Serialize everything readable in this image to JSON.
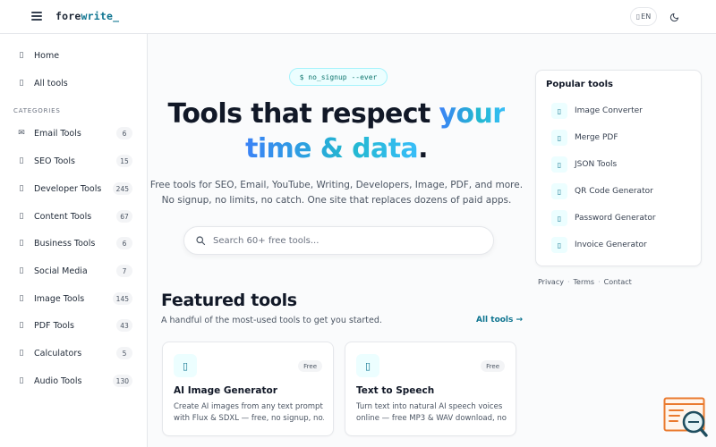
{
  "header": {
    "logo_part1": "fore",
    "logo_part2": "write",
    "logo_cursor": "_",
    "lang_label": "EN"
  },
  "sidebar": {
    "top_items": [
      {
        "label": "Home",
        "icon": "home-icon"
      },
      {
        "label": "All tools",
        "icon": "grid-icon"
      }
    ],
    "category_heading": "CATEGORIES",
    "categories": [
      {
        "label": "Email Tools",
        "count": "6",
        "icon": "mail-icon"
      },
      {
        "label": "SEO Tools",
        "count": "15",
        "icon": "seo-icon"
      },
      {
        "label": "Developer Tools",
        "count": "245",
        "icon": "code-icon"
      },
      {
        "label": "Content Tools",
        "count": "67",
        "icon": "content-icon"
      },
      {
        "label": "Business Tools",
        "count": "6",
        "icon": "briefcase-icon"
      },
      {
        "label": "Social Media",
        "count": "7",
        "icon": "social-icon"
      },
      {
        "label": "Image Tools",
        "count": "145",
        "icon": "image-icon"
      },
      {
        "label": "PDF Tools",
        "count": "43",
        "icon": "pdf-icon"
      },
      {
        "label": "Calculators",
        "count": "5",
        "icon": "calculator-icon"
      },
      {
        "label": "Audio Tools",
        "count": "130",
        "icon": "audio-icon"
      }
    ]
  },
  "hero": {
    "badge": "$ no_signup --ever",
    "title_line1_a": "Tools that respect ",
    "title_line1_b": "your",
    "title_line2_a": "time & data",
    "title_line2_b": ".",
    "subtitle_line1": "Free tools for SEO, Email, YouTube, Writing, Developers, Image, PDF, and more.",
    "subtitle_line2": "No signup, no limits, no catch. One site that replaces dozens of paid apps."
  },
  "search": {
    "placeholder": "Search 60+ free tools..."
  },
  "featured": {
    "title": "Featured tools",
    "subtitle": "A handful of the most-used tools to get you started.",
    "all_link": "All tools →",
    "cards": [
      {
        "badge": "Free",
        "title": "AI Image Generator",
        "desc_line1": "Create AI images from any text prompt",
        "desc_line2": "with Flux & SDXL — free, no signup, no...",
        "icon": "image-generator-icon"
      },
      {
        "badge": "Free",
        "title": "Text to Speech",
        "desc_line1": "Turn text into natural AI speech voices",
        "desc_line2": "online — free MP3 & WAV download, no...",
        "icon": "speech-icon"
      }
    ]
  },
  "popular": {
    "title": "Popular tools",
    "items": [
      {
        "label": "Image Converter",
        "icon": "image-converter-icon"
      },
      {
        "label": "Merge PDF",
        "icon": "merge-pdf-icon"
      },
      {
        "label": "JSON Tools",
        "icon": "json-icon"
      },
      {
        "label": "QR Code Generator",
        "icon": "qr-icon"
      },
      {
        "label": "Password Generator",
        "icon": "password-icon"
      },
      {
        "label": "Invoice Generator",
        "icon": "invoice-icon"
      }
    ]
  },
  "footer": {
    "privacy": "Privacy",
    "terms": "Terms",
    "contact": "Contact",
    "sep": "·"
  },
  "colors": {
    "accent": "#0e7490",
    "gradient_start": "#3b82f6",
    "gradient_end": "#38bdf8"
  }
}
